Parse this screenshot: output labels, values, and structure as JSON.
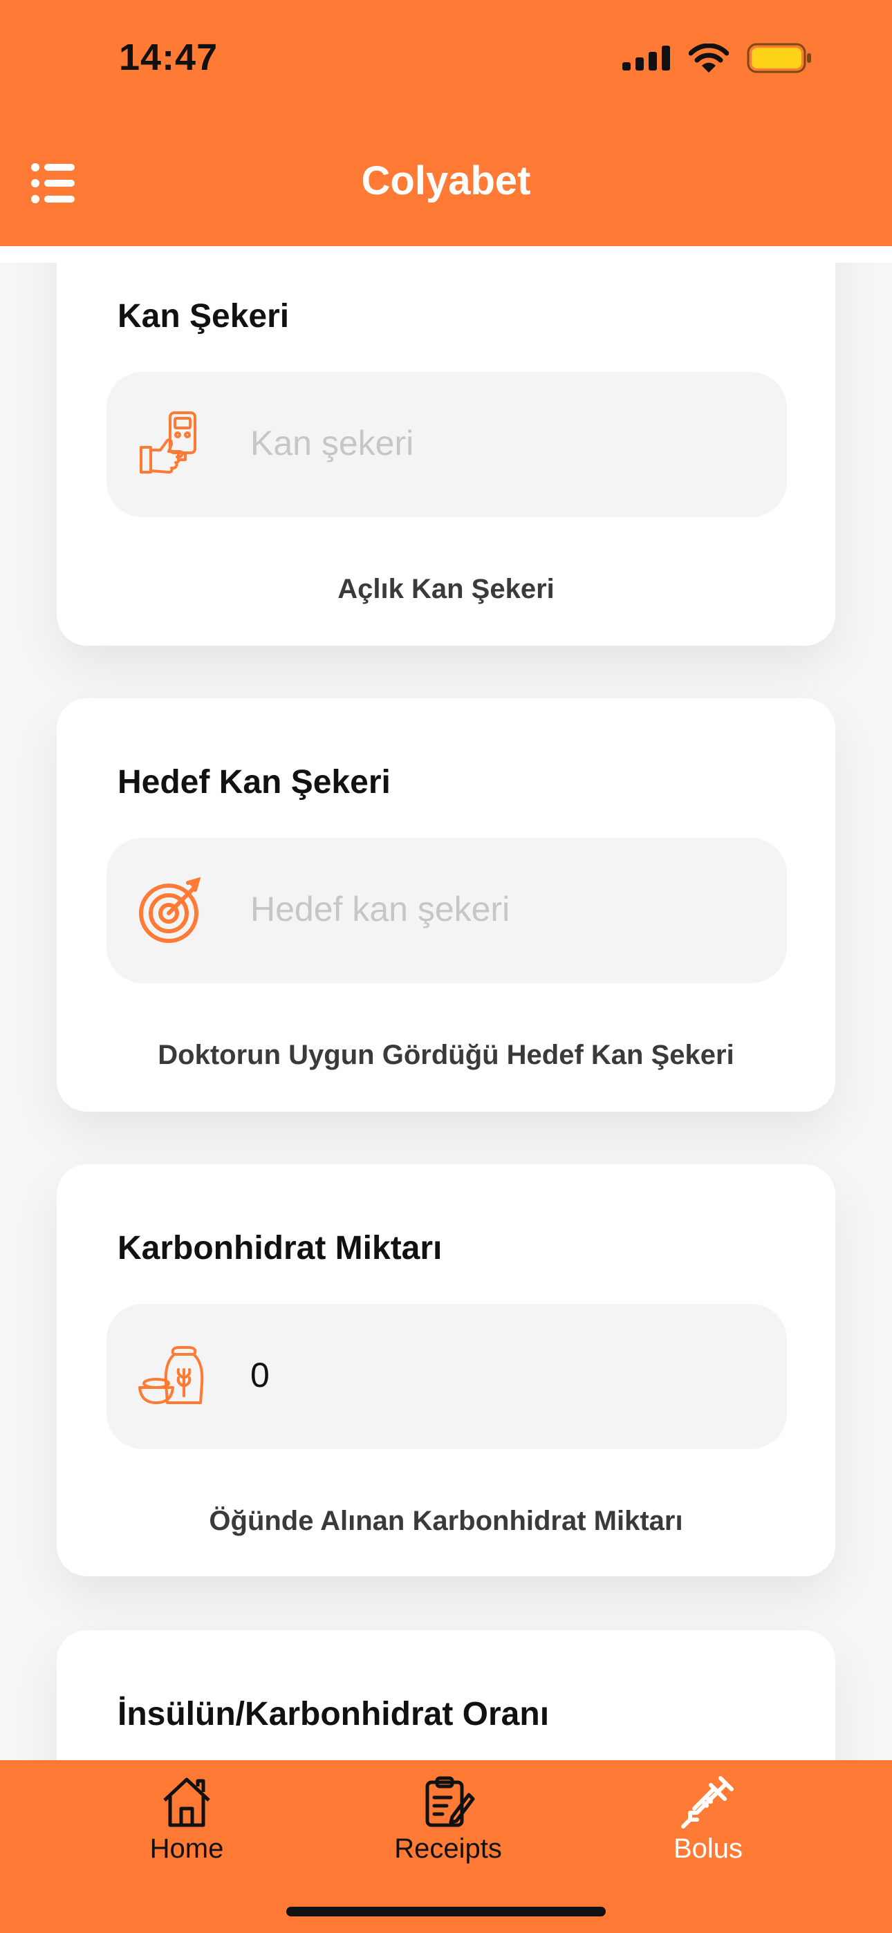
{
  "status_bar": {
    "time": "14:47"
  },
  "app": {
    "title": "Colyabet",
    "accent_color": "#ff7a35"
  },
  "cards": [
    {
      "title": "Kan Şekeri",
      "icon": "glucose-meter-icon",
      "placeholder": "Kan şekeri",
      "value": "",
      "caption": "Açlık Kan Şekeri"
    },
    {
      "title": "Hedef Kan Şekeri",
      "icon": "target-icon",
      "placeholder": "Hedef kan şekeri",
      "value": "",
      "caption": "Doktorun Uygun Gördüğü Hedef Kan Şekeri"
    },
    {
      "title": "Karbonhidrat Miktarı",
      "icon": "grain-sack-icon",
      "placeholder": "",
      "value": "0",
      "caption": "Öğünde Alınan Karbonhidrat Miktarı"
    },
    {
      "title": "İnsülün/Karbonhidrat Oranı"
    }
  ],
  "tabs": [
    {
      "label": "Home",
      "icon": "home-icon",
      "active": false
    },
    {
      "label": "Receipts",
      "icon": "receipt-icon",
      "active": false
    },
    {
      "label": "Bolus",
      "icon": "syringe-icon",
      "active": true
    }
  ]
}
